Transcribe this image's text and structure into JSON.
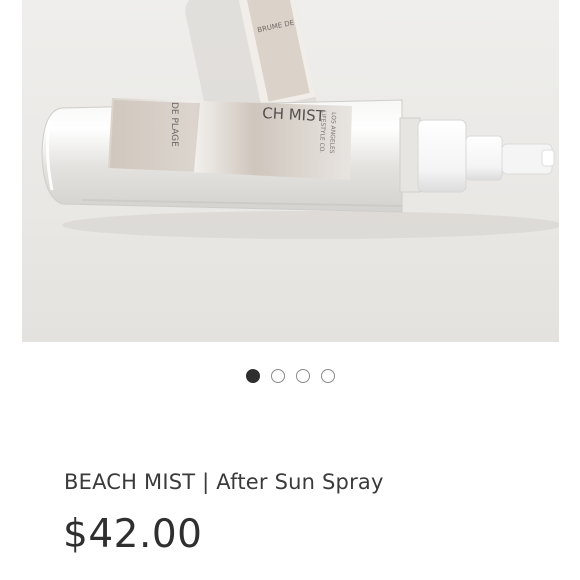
{
  "product": {
    "image_alt": "BEACH MIST After Sun Spray bottle",
    "label_text_main": "CH MIST",
    "label_text_sub": "DE PLAGE",
    "label_text_brand": "LIFESTYLE CO.",
    "label_text_city": "LOS ANGELES",
    "label_text_back": "BRUME DE",
    "title": "BEACH MIST | After Sun Spray",
    "price": "$42.00"
  },
  "carousel": {
    "count": 4,
    "active_index": 0
  },
  "colors": {
    "dot_active": "#2e2e2e",
    "dot_inactive_border": "#8a8a8a",
    "text": "#3a3a3a",
    "image_background": "#ecebea"
  }
}
